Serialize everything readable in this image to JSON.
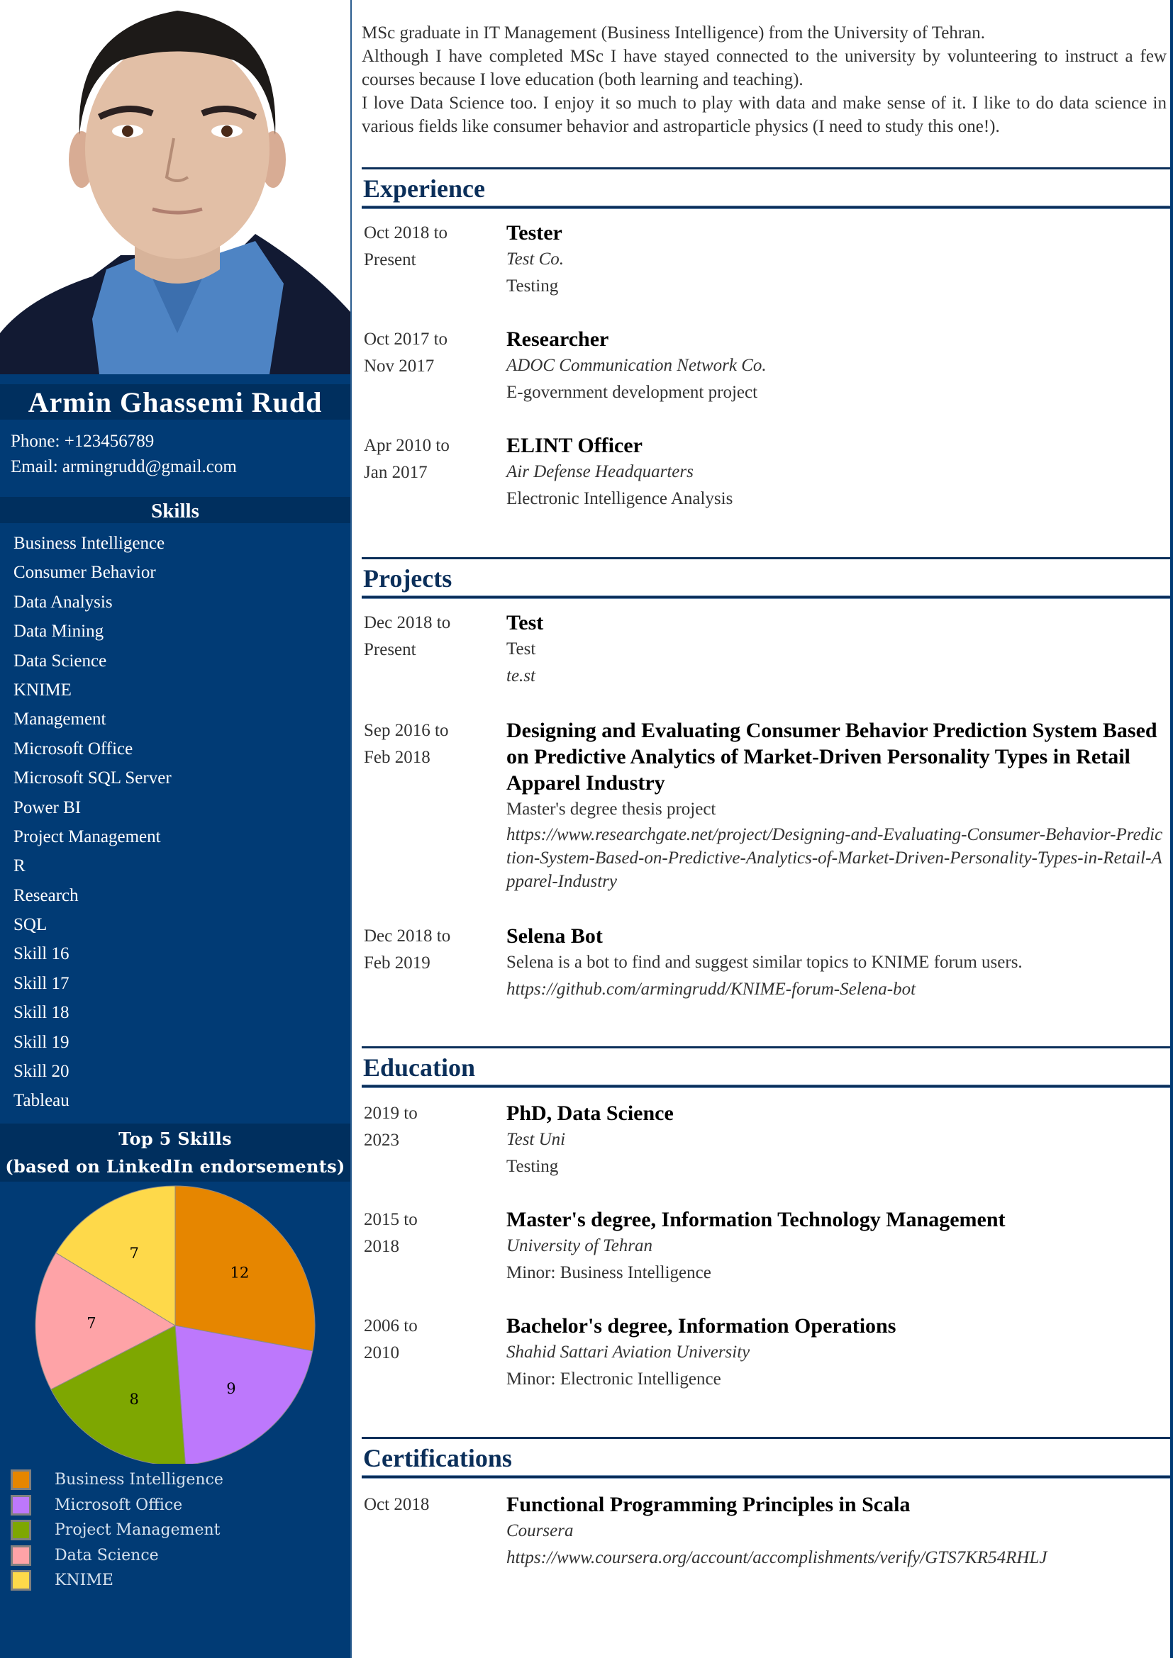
{
  "profile": {
    "name": "Armin Ghassemi Rudd",
    "phone": "Phone: +123456789",
    "email": "Email: armingrudd@gmail.com"
  },
  "sidebar": {
    "skills_title": "Skills",
    "skills": [
      "Business Intelligence",
      "Consumer Behavior",
      "Data Analysis",
      "Data Mining",
      "Data Science",
      "KNIME",
      "Management",
      "Microsoft Office",
      "Microsoft SQL Server",
      "Power BI",
      "Project Management",
      "R",
      "Research",
      "SQL",
      "Skill 16",
      "Skill 17",
      "Skill 18",
      "Skill 19",
      "Skill 20",
      "Tableau"
    ],
    "chart_title_line1": "Top 5 Skills",
    "chart_title_line2": "(based on LinkedIn endorsements)"
  },
  "chart_data": {
    "type": "pie",
    "title": "Top 5 Skills (based on LinkedIn endorsements)",
    "categories": [
      "Business Intelligence",
      "Microsoft Office",
      "Project Management",
      "Data Science",
      "KNIME"
    ],
    "values": [
      12,
      9,
      8,
      7,
      7
    ],
    "colors": [
      "#e68600",
      "#bd78fc",
      "#7ea701",
      "#fea3a7",
      "#fed94a"
    ],
    "data_labels": [
      "12",
      "9",
      "8",
      "7",
      "7"
    ],
    "start_angle": "top",
    "direction": "clockwise",
    "legend": "bottom-left"
  },
  "summary": [
    "MSc graduate in IT Management (Business Intelligence) from the University of Tehran.",
    "Although I have completed MSc I have stayed connected to the university by volunteering to instruct a few courses because I love education (both learning and teaching).",
    "I love Data Science too. I enjoy it so much to play with data and make sense of it. I like to do data science in various fields like consumer behavior and astroparticle physics (I need to study this one!)."
  ],
  "sections": {
    "experience": {
      "title": "Experience",
      "items": [
        {
          "date1": "Oct 2018 to",
          "date2": "Present",
          "title": "Tester",
          "org": "Test Co.",
          "desc": "Testing"
        },
        {
          "date1": "Oct 2017 to",
          "date2": "Nov 2017",
          "title": "Researcher",
          "org": "ADOC Communication Network Co.",
          "desc": "E-government development project"
        },
        {
          "date1": "Apr 2010 to",
          "date2": "Jan 2017",
          "title": "ELINT Officer",
          "org": "Air Defense Headquarters",
          "desc": "Electronic Intelligence Analysis"
        }
      ]
    },
    "projects": {
      "title": "Projects",
      "items": [
        {
          "date1": "Dec 2018 to",
          "date2": "Present",
          "title": "Test",
          "desc": "Test",
          "url": "te.st"
        },
        {
          "date1": "Sep 2016 to",
          "date2": "Feb 2018",
          "title": "Designing and Evaluating Consumer Behavior Prediction System Based on Predictive Analytics of Market-Driven Personality Types in Retail Apparel Industry",
          "desc": "Master's degree thesis project",
          "url": "https://www.researchgate.net/project/Designing-and-Evaluating-Consumer-Behavior-Prediction-System-Based-on-Predictive-Analytics-of-Market-Driven-Personality-Types-in-Retail-Apparel-Industry"
        },
        {
          "date1": "Dec 2018 to",
          "date2": "Feb 2019",
          "title": "Selena Bot",
          "desc": "Selena is a bot to find and suggest similar topics to KNIME forum users.",
          "url": "https://github.com/armingrudd/KNIME-forum-Selena-bot"
        }
      ]
    },
    "education": {
      "title": "Education",
      "items": [
        {
          "date1": "2019 to",
          "date2": "2023",
          "title": "PhD, Data Science",
          "org": "Test Uni",
          "desc": "Testing"
        },
        {
          "date1": "2015 to",
          "date2": "2018",
          "title": "Master's degree, Information Technology Management",
          "org": "University of Tehran",
          "desc": "Minor: Business Intelligence"
        },
        {
          "date1": "2006 to",
          "date2": "2010",
          "title": "Bachelor's degree, Information Operations",
          "org": "Shahid Sattari Aviation University",
          "desc": "Minor: Electronic Intelligence"
        }
      ]
    },
    "certifications": {
      "title": "Certifications",
      "items": [
        {
          "date1": "Oct 2018",
          "title": "Functional Programming Principles in Scala",
          "org": "Coursera",
          "url": "https://www.coursera.org/account/accomplishments/verify/GTS7KR54RHLJ"
        }
      ]
    }
  },
  "colors": {
    "sidebar_bg": "#013b75",
    "band_bg": "#002f5e",
    "heading": "#0b2f5a"
  }
}
